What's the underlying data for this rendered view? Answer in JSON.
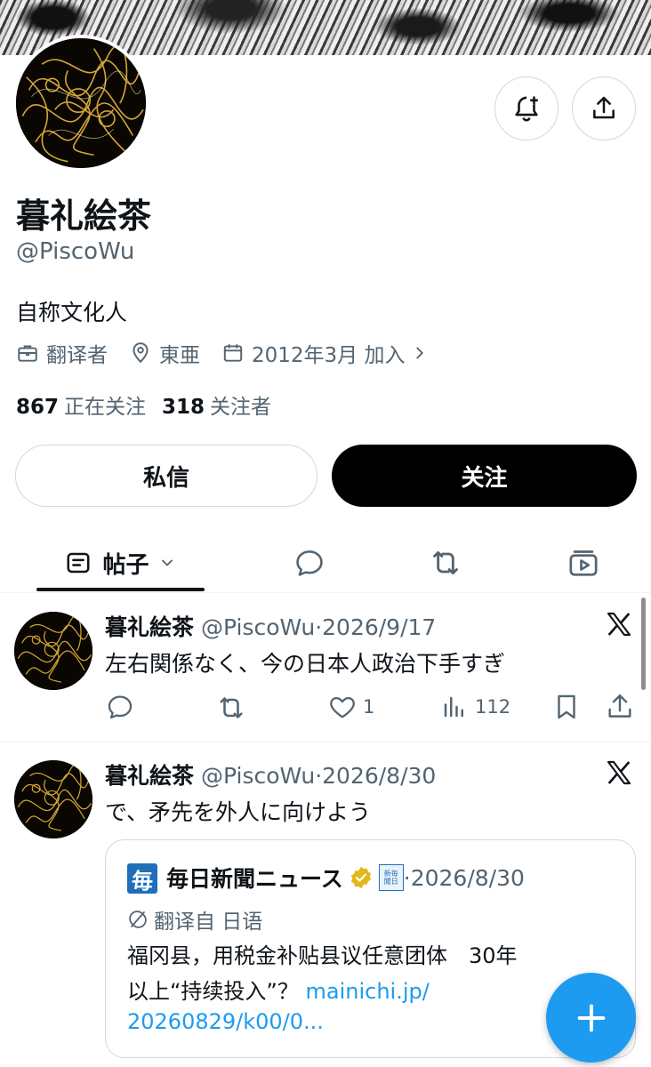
{
  "colors": {
    "accent": "#1d9bf0",
    "text": "#0f1419",
    "secondary": "#536471",
    "border": "#cfd9de",
    "verified": "#e2b719",
    "mainichi_blue": "#1f6fb8"
  },
  "profile": {
    "name": "暮礼絵茶",
    "handle": "@PiscoWu",
    "bio": "自称文化人",
    "occupation": "翻译者",
    "location": "東亜",
    "joined": "2012年3月 加入",
    "following_count": "867",
    "following_label": "正在关注",
    "followers_count": "318",
    "followers_label": "关注者"
  },
  "buttons": {
    "notify_icon": "bell-plus-icon",
    "share_icon": "share-icon",
    "dm": "私信",
    "follow": "关注"
  },
  "tabs": [
    {
      "label": "帖子",
      "icon": "posts-icon",
      "active": true
    },
    {
      "icon": "reply-bubble-icon"
    },
    {
      "icon": "repost-icon"
    },
    {
      "icon": "media-icon"
    }
  ],
  "tweets": [
    {
      "name": "暮礼絵茶",
      "handle": "@PiscoWu",
      "sep": "·",
      "date": "2026/9/17",
      "text": "左右関係なく、今の日本人政治下手すぎ",
      "likes": "1",
      "views": "112"
    },
    {
      "name": "暮礼絵茶",
      "handle": "@PiscoWu",
      "sep": "·",
      "date": "2026/8/30",
      "text": "で、矛先を外人に向けよう",
      "quote": {
        "logo_char": "毎",
        "name": "毎日新聞ニュース",
        "badge_text": "新毎\n聞日",
        "sep": "·",
        "date": "2026/8/30",
        "translated_label": "翻译自 日语",
        "text_line1": "福冈县，用税金补贴县议任意团体　30年",
        "text_line2a": "以上“持续投入”？ ",
        "link_part1": "mainichi.jp/",
        "link_part2": "20260829/k00/0..."
      }
    }
  ],
  "fab_icon": "plus-icon"
}
